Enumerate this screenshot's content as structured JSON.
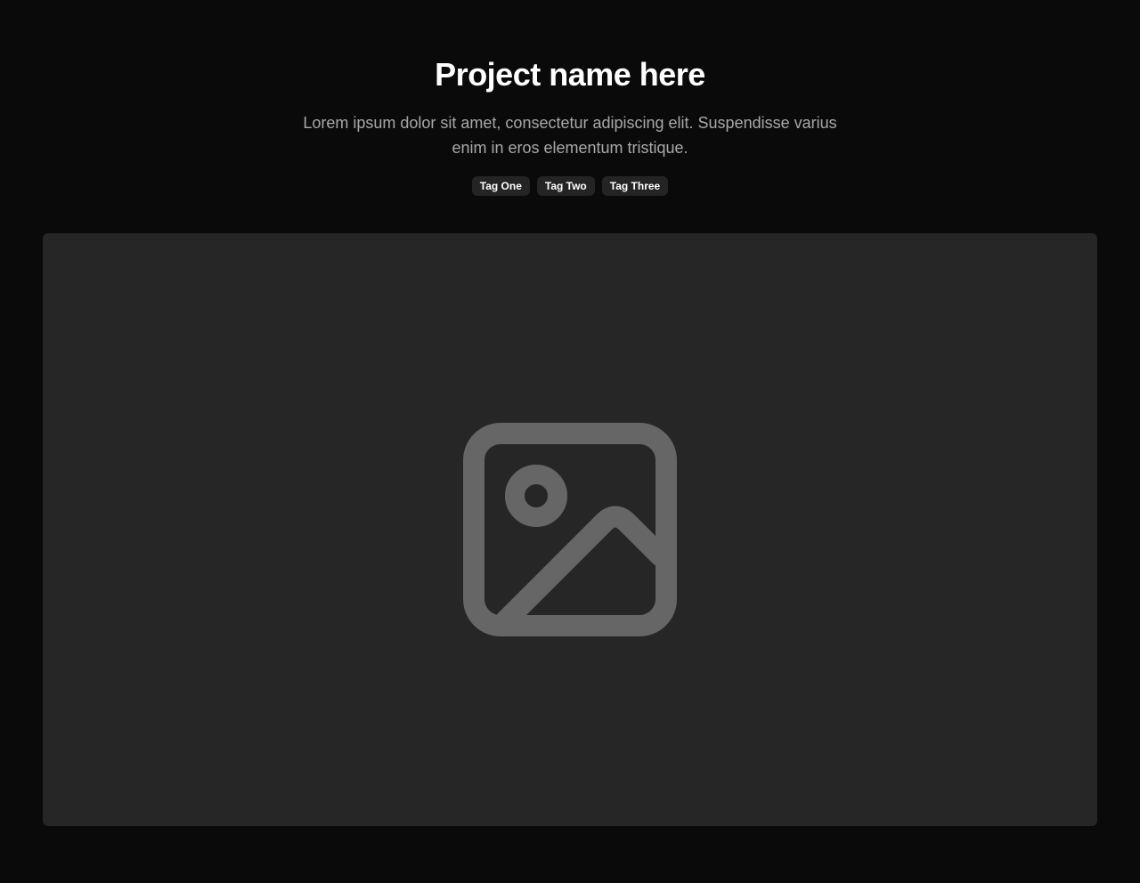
{
  "header": {
    "title": "Project name here",
    "description": "Lorem ipsum dolor sit amet, consectetur adipiscing elit. Suspendisse varius enim in eros elementum tristique."
  },
  "tags": [
    {
      "label": "Tag One"
    },
    {
      "label": "Tag Two"
    },
    {
      "label": "Tag Three"
    }
  ],
  "media": {
    "icon": "image-placeholder-icon"
  },
  "colors": {
    "background": "#0a0a0a",
    "surface": "#262626",
    "tag_background": "#242424",
    "text_primary": "#ffffff",
    "text_secondary": "#a8a8a8",
    "icon": "#666666"
  }
}
